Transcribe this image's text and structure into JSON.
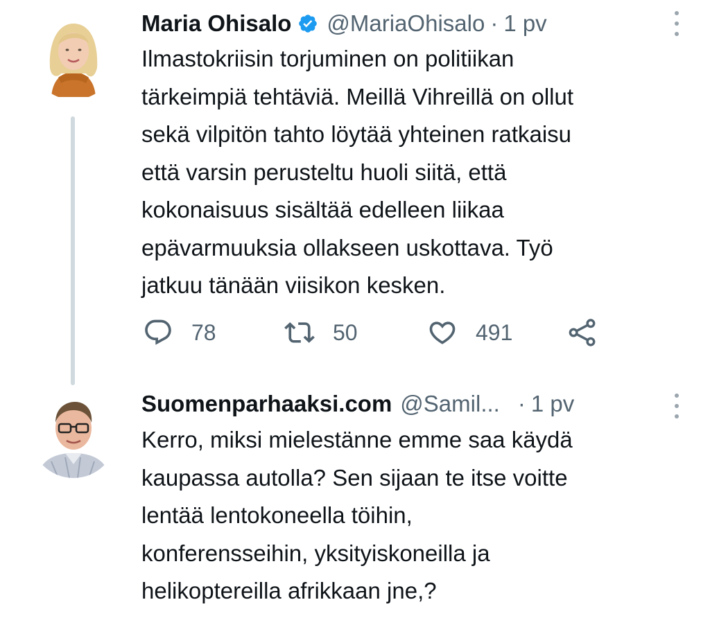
{
  "tweets": [
    {
      "display_name": "Maria Ohisalo",
      "verified": true,
      "handle": "@MariaOhisalo",
      "separator": "·",
      "time": "1 pv",
      "text": "Ilmastokriisin torjuminen on politiikan\ntärkeimpiä tehtäviä. Meillä Vihreillä on ollut\nsekä vilpitön tahto löytää yhteinen ratkaisu\nettä varsin perusteltu huoli siitä, että\nkokonaisuus sisältää edelleen liikaa\nepävarmuuksia ollakseen uskottava. Työ\njatkuu tänään viisikon kesken.",
      "actions": {
        "replies": "78",
        "retweets": "50",
        "likes": "491"
      }
    },
    {
      "display_name": "Suomenparhaaksi.com",
      "handle": "@Samil...",
      "separator": "·",
      "time": "1 pv",
      "text": "Kerro, miksi mielestänne emme saa käydä\nkaupassa autolla? Sen sijaan te itse voitte\nlentää lentokoneella töihin,\nkonferensseihin, yksityiskoneilla ja\nhelikoptereilla afrikkaan jne,?"
    }
  ],
  "icons": {
    "verified": "verified-badge-icon",
    "more": "more-vertical-icon",
    "reply": "reply-icon",
    "retweet": "retweet-icon",
    "like": "heart-icon",
    "share": "share-icon"
  },
  "colors": {
    "text": "#0f1419",
    "secondary": "#536471",
    "verified": "#1d9bf0",
    "thread_line": "#cfd9de"
  }
}
